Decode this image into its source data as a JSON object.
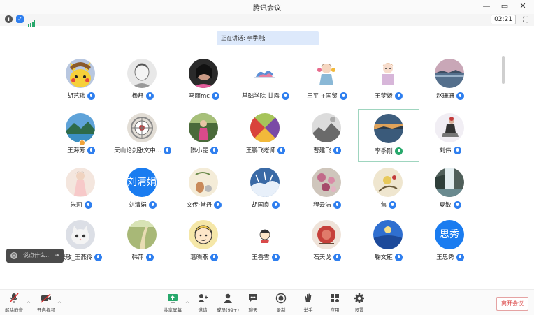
{
  "window": {
    "title": "腾讯会议",
    "controls": [
      "—",
      "▭",
      "✕"
    ]
  },
  "info": {
    "timer": "02:21",
    "fullscreen": "⛶"
  },
  "speaking": {
    "text": "正在讲话: 李季刚;"
  },
  "participants": [
    {
      "name": "胡艺玮",
      "av": "pikachu"
    },
    {
      "name": "杨舒",
      "av": "sketch"
    },
    {
      "name": "马丽mc",
      "av": "dark-portrait"
    },
    {
      "name": "基础学院 甘露",
      "av": "waves"
    },
    {
      "name": "王平 +国贸",
      "av": "cartoon-girl"
    },
    {
      "name": "王梦娇",
      "av": "doll"
    },
    {
      "name": "赵珊珊",
      "av": "lake"
    },
    {
      "name": "王海芳",
      "av": "mountain",
      "badge": true
    },
    {
      "name": "天山论剑张文中...",
      "av": "mandala"
    },
    {
      "name": "陈小昆",
      "av": "person-outdoor"
    },
    {
      "name": "王鹏飞老师",
      "av": "colorblock"
    },
    {
      "name": "曹建飞",
      "av": "bw-scene"
    },
    {
      "name": "李季刚",
      "av": "sunset-lake",
      "active": true
    },
    {
      "name": "刘伟",
      "av": "sitting-person"
    },
    {
      "name": "朱莉",
      "av": "woman-dress"
    },
    {
      "name": "刘清娟",
      "av": "text",
      "text": "刘清娟"
    },
    {
      "name": "文传·常丹",
      "av": "still-life"
    },
    {
      "name": "胡国良",
      "av": "frost"
    },
    {
      "name": "程云洁",
      "av": "flowers"
    },
    {
      "name": "焦",
      "av": "painting"
    },
    {
      "name": "夏敏",
      "av": "waterfall"
    },
    {
      "name": "张敬_王燕伶",
      "av": "kitten"
    },
    {
      "name": "韩萍",
      "av": "path"
    },
    {
      "name": "葛晓燕",
      "av": "cartoon-face"
    },
    {
      "name": "王香雪",
      "av": "small-cartoon"
    },
    {
      "name": "石天戈",
      "av": "red-food"
    },
    {
      "name": "鞠文雁",
      "av": "blue-sky"
    },
    {
      "name": "王思秀",
      "av": "text",
      "text": "思秀"
    }
  ],
  "chat": {
    "placeholder": "说点什么...",
    "send": "⇥"
  },
  "toolbar": {
    "mute": "解除静音",
    "video": "开启视频",
    "share": "共享屏幕",
    "invite": "邀请",
    "members": "成员(99+)",
    "chat": "聊天",
    "record": "录制",
    "raise": "举手",
    "apps": "应用",
    "settings": "设置",
    "leave": "离开会议"
  },
  "colors": {
    "accent": "#2f7fef",
    "speaking_bg": "#dde9fb",
    "leave": "#d93b3b",
    "active_border": "#9fd5bf"
  }
}
